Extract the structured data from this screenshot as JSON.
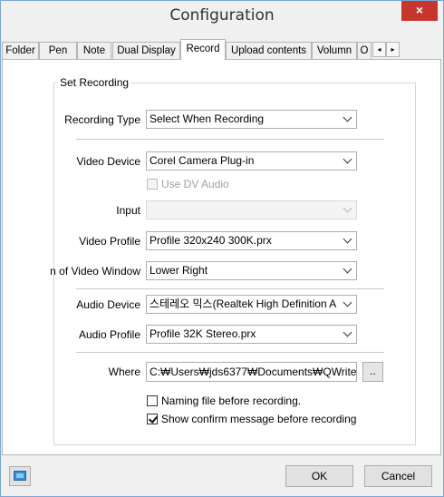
{
  "window": {
    "title": "Configuration",
    "close_glyph": "×"
  },
  "tabs": [
    {
      "label": "Folder"
    },
    {
      "label": "Pen"
    },
    {
      "label": "Note"
    },
    {
      "label": "Dual Display"
    },
    {
      "label": "Record",
      "active": true
    },
    {
      "label": "Upload contents"
    },
    {
      "label": "Volumn"
    },
    {
      "label": "O"
    }
  ],
  "tab_scroll": {
    "left": "◂",
    "right": "▸"
  },
  "record": {
    "group_title": "Set Recording",
    "recording_type": {
      "label": "Recording Type",
      "value": "Select When Recording"
    },
    "video_device": {
      "label": "Video Device",
      "value": "Corel Camera Plug-in"
    },
    "use_dv_audio": {
      "label": "Use DV Audio",
      "checked": false,
      "enabled": false
    },
    "input": {
      "label": "Input",
      "value": "",
      "enabled": false
    },
    "video_profile": {
      "label": "Video Profile",
      "value": "Profile 320x240 300K.prx"
    },
    "video_window": {
      "label": "n of Video Window",
      "value": "Lower Right"
    },
    "audio_device": {
      "label": "Audio Device",
      "value": "스테레오 믹스(Realtek High Definition A"
    },
    "audio_profile": {
      "label": "Audio Profile",
      "value": "Profile 32K Stereo.prx"
    },
    "where": {
      "label": "Where",
      "value": "C:₩Users₩jds6377₩Documents₩QWrite",
      "browse_label": ".."
    },
    "naming_before": {
      "label": "Naming file before recording.",
      "checked": false
    },
    "show_confirm": {
      "label": "Show confirm message before recording",
      "checked": true
    }
  },
  "footer": {
    "ok_label": "OK",
    "cancel_label": "Cancel",
    "icon": "display-icon"
  },
  "colors": {
    "close_bg": "#c7362c",
    "window_border": "#7aa7d6",
    "icon_blue": "#2e8fd6"
  }
}
